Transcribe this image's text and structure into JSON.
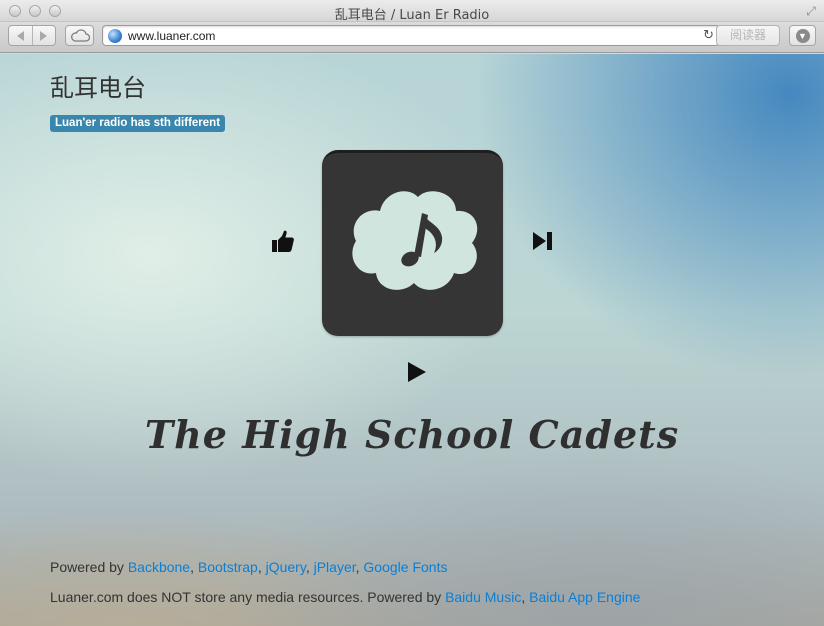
{
  "window": {
    "title": "乱耳电台 / Luan Er Radio"
  },
  "toolbar": {
    "url": "www.luaner.com",
    "reader_label": "阅读器"
  },
  "icons": {
    "back": "back-arrow-icon",
    "forward": "forward-arrow-icon",
    "cloud": "icloud-tabs-icon",
    "globe": "globe-icon",
    "reload": "reload-icon",
    "download": "download-icon",
    "like": "thumbs-up-icon",
    "next": "next-track-icon",
    "play": "play-icon",
    "music": "music-note-icon"
  },
  "page": {
    "site_title": "乱耳电台",
    "tagline": "Luan'er radio has sth different",
    "song_title": "The High School Cadets"
  },
  "footer": {
    "line1_prefix": "Powered by ",
    "line1_links": [
      "Backbone",
      "Bootstrap",
      "jQuery",
      "jPlayer",
      "Google Fonts"
    ],
    "line2_prefix": "Luaner.com does NOT store any media resources. Powered by ",
    "line2_links": [
      "Baidu Music",
      "Baidu App Engine"
    ],
    "separator": ", "
  },
  "colors": {
    "tagline_bg": "#3a87ad",
    "link": "#0a7fd6",
    "cover_bg": "#353535",
    "cloud": "#cfe5dd"
  }
}
